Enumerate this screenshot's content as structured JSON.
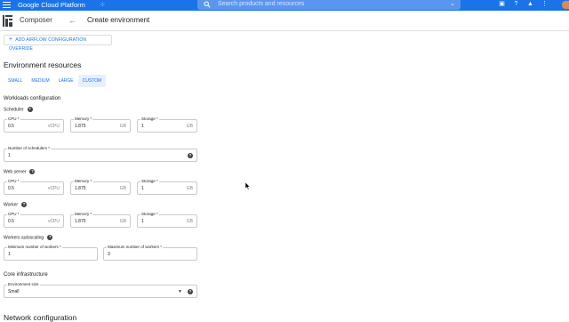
{
  "topbar": {
    "brand": "Google Cloud Platform",
    "project_icon": "project-switcher-icon",
    "search_placeholder": "Search products and resources",
    "icons": [
      "cloud-shell-icon",
      "help-icon",
      "notifications-icon",
      "more-vert-icon"
    ]
  },
  "appbar": {
    "app_name": "Composer",
    "page_title": "Create environment"
  },
  "override_button": "ADD AIRFLOW CONFIGURATION OVERRIDE",
  "environment_resources": {
    "title": "Environment resources",
    "tabs": [
      "SMALL",
      "MEDIUM",
      "LARGE",
      "CUSTOM"
    ],
    "active_tab": "CUSTOM"
  },
  "workloads": {
    "title": "Workloads configuration",
    "scheduler": {
      "label": "Scheduler",
      "cpu": {
        "label": "CPU *",
        "value": "0.5",
        "unit": "vCPU"
      },
      "memory": {
        "label": "Memory *",
        "value": "1.875",
        "unit": "GB"
      },
      "storage": {
        "label": "Storage *",
        "value": "1",
        "unit": "GB"
      },
      "num_schedulers": {
        "label": "Number of schedulers *",
        "value": "1"
      }
    },
    "web_server": {
      "label": "Web server",
      "cpu": {
        "label": "CPU *",
        "value": "0.5",
        "unit": "vCPU"
      },
      "memory": {
        "label": "Memory *",
        "value": "1.875",
        "unit": "GB"
      },
      "storage": {
        "label": "Storage *",
        "value": "1",
        "unit": "GB"
      }
    },
    "worker": {
      "label": "Worker",
      "cpu": {
        "label": "CPU *",
        "value": "0.5",
        "unit": "vCPU"
      },
      "memory": {
        "label": "Memory *",
        "value": "1.875",
        "unit": "GB"
      },
      "storage": {
        "label": "Storage *",
        "value": "1",
        "unit": "GB"
      }
    },
    "autoscaling": {
      "label": "Workers autoscaling",
      "min": {
        "label": "Minimum number of workers *",
        "value": "1"
      },
      "max": {
        "label": "Maximum number of workers *",
        "value": "3"
      }
    }
  },
  "core_infrastructure": {
    "title": "Core infrastructure",
    "environment_size": {
      "label": "Environment size",
      "value": "Small"
    }
  },
  "network_configuration": {
    "title": "Network configuration"
  },
  "colors": {
    "topbar": "#1a73e8",
    "accent": "#1a73e8",
    "active_tab_bg": "#e8f0fe"
  }
}
